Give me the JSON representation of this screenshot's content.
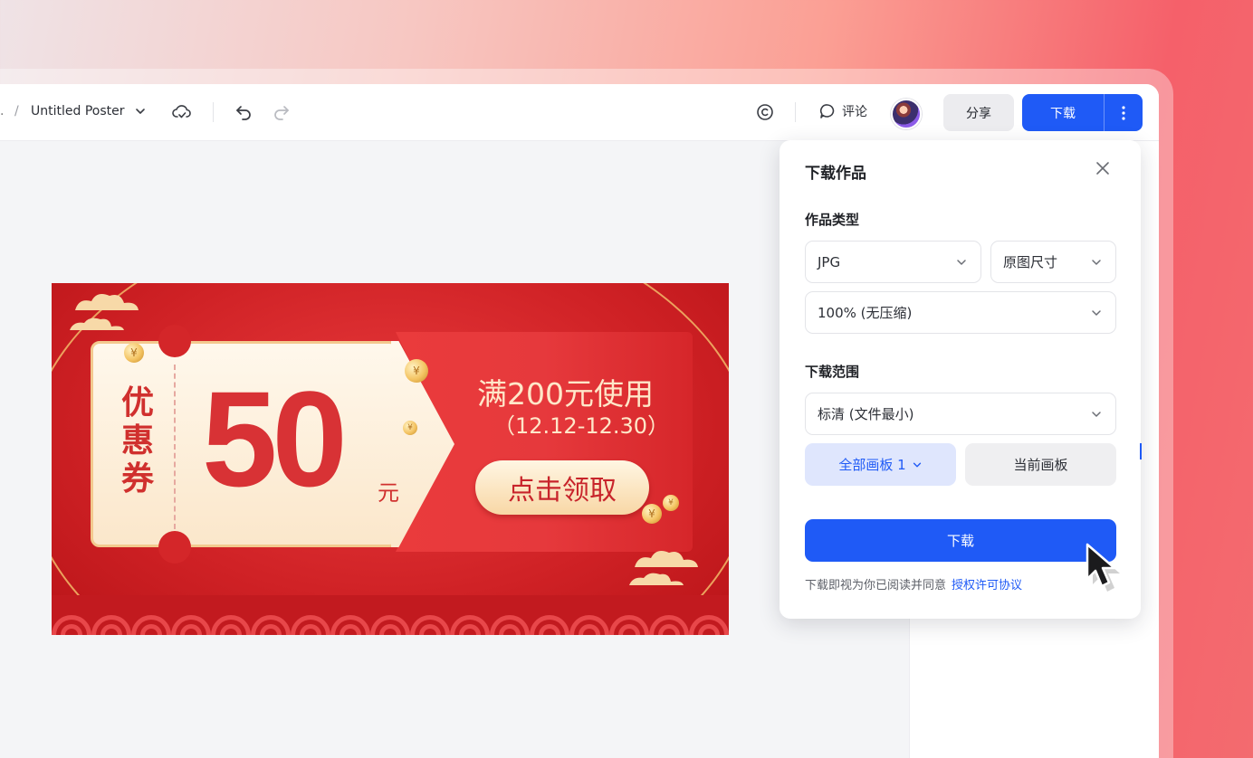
{
  "toolbar": {
    "breadcrumb_ellipsis": ".",
    "breadcrumb_sep": "/",
    "title": "Untitled Poster",
    "comment_label": "评论",
    "share_label": "分享",
    "download_label": "下载"
  },
  "poster": {
    "ticket_label": "优惠券",
    "amount": "50",
    "unit": "元",
    "condition": "满200元使用",
    "dates": "（12.12-12.30）",
    "claim_label": "点击领取",
    "coin_symbol": "¥"
  },
  "download_panel": {
    "title": "下载作品",
    "type_section": "作品类型",
    "format_value": "JPG",
    "size_value": "原图尺寸",
    "quality_value": "100% (无压缩)",
    "range_section": "下载范围",
    "resolution_value": "标清 (文件最小)",
    "all_boards_label": "全部画板 1",
    "current_board_label": "当前画板",
    "download_label": "下载",
    "terms_text": "下载即视为你已阅读并同意",
    "terms_link": "授权许可协议"
  },
  "colors": {
    "accent": "#1f5af6",
    "poster_red": "#d42629",
    "poster_gold": "#f5c46e"
  },
  "icons": [
    "chevron-down-icon",
    "cloud-sync-icon",
    "undo-icon",
    "redo-icon",
    "copyright-icon",
    "comment-icon",
    "more-vertical-icon",
    "close-icon",
    "cursor-icon"
  ]
}
